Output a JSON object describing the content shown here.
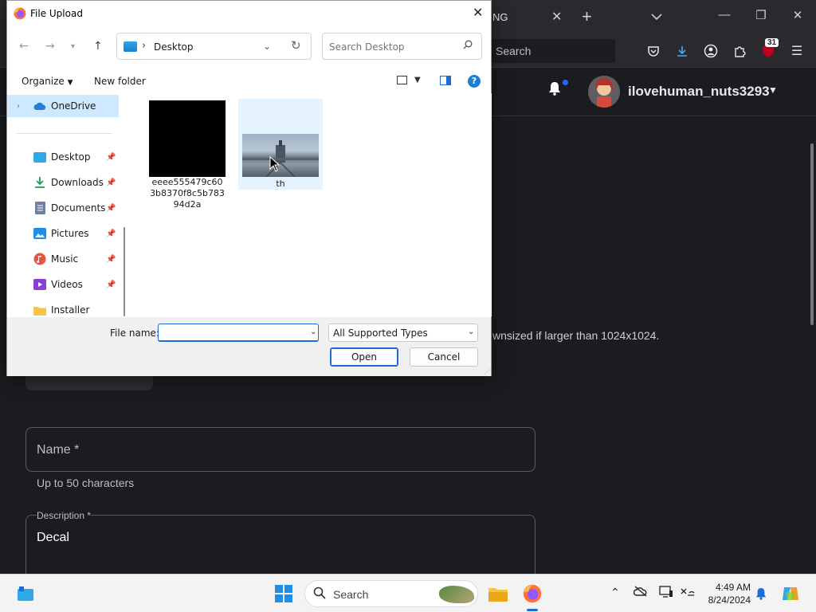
{
  "browser": {
    "tab_title": "NG",
    "url_search_label": "Search",
    "badge_count": "31"
  },
  "page": {
    "username": "ilovehuman_nuts3293",
    "hint": "wnsized if larger than 1024x1024.",
    "name_label": "Name *",
    "name_help": "Up to 50 characters",
    "description_label": "Description *",
    "description_value": "Decal"
  },
  "dialog": {
    "title": "File Upload",
    "address": {
      "location": "Desktop"
    },
    "search_placeholder": "Search Desktop",
    "commands": {
      "organize": "Organize",
      "new_folder": "New folder"
    },
    "nav_items": [
      {
        "label": "OneDrive",
        "icon": "onedrive-icon",
        "pinned": false,
        "selected": true
      },
      {
        "label": "Desktop",
        "icon": "desktop-icon",
        "pinned": true
      },
      {
        "label": "Downloads",
        "icon": "downloads-icon",
        "pinned": true
      },
      {
        "label": "Documents",
        "icon": "documents-icon",
        "pinned": true
      },
      {
        "label": "Pictures",
        "icon": "pictures-icon",
        "pinned": true
      },
      {
        "label": "Music",
        "icon": "music-icon",
        "pinned": true
      },
      {
        "label": "Videos",
        "icon": "videos-icon",
        "pinned": true
      },
      {
        "label": "Installer",
        "icon": "folder-icon",
        "pinned": false
      }
    ],
    "files": [
      {
        "name": "eeee555479c603b8370f8c5b78394d2a",
        "thumbnail": "black"
      },
      {
        "name": "th",
        "thumbnail": "photo"
      }
    ],
    "file_name_label": "File name:",
    "file_name_value": "",
    "file_type": "All Supported Types",
    "open_button": "Open",
    "cancel_button": "Cancel"
  },
  "taskbar": {
    "search_label": "Search",
    "time": "4:49 AM",
    "date": "8/24/2024"
  },
  "colors": {
    "accent": "#1e6bd6",
    "selection": "#cde8ff",
    "page_bg": "#1b1c1f",
    "chrome_bg": "#2a2a2e"
  }
}
